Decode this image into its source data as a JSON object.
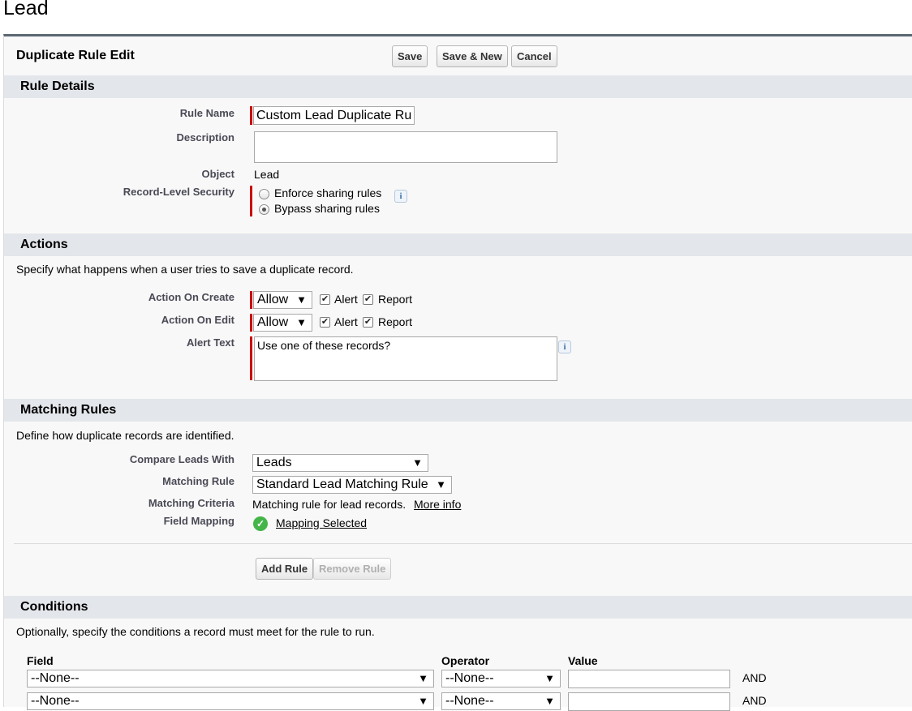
{
  "page_title": "Lead",
  "header": {
    "title": "Duplicate Rule Edit",
    "save_label": "Save",
    "save_new_label": "Save & New",
    "cancel_label": "Cancel"
  },
  "rule_details": {
    "heading": "Rule Details",
    "rule_name_label": "Rule Name",
    "rule_name_value": "Custom Lead Duplicate Rul",
    "description_label": "Description",
    "description_value": "",
    "object_label": "Object",
    "object_value": "Lead",
    "security_label": "Record-Level Security",
    "security_options": [
      "Enforce sharing rules",
      "Bypass sharing rules"
    ],
    "security_selected": "Bypass sharing rules",
    "info_glyph": "i"
  },
  "actions": {
    "heading": "Actions",
    "description": "Specify what happens when a user tries to save a duplicate record.",
    "on_create_label": "Action On Create",
    "on_create_value": "Allow",
    "on_edit_label": "Action On Edit",
    "on_edit_value": "Allow",
    "alert_label": "Alert",
    "report_label": "Report",
    "on_create_alert_checked": true,
    "on_create_report_checked": true,
    "on_edit_alert_checked": true,
    "on_edit_report_checked": true,
    "alert_text_label": "Alert Text",
    "alert_text_value": "Use one of these records?"
  },
  "matching_rules": {
    "heading": "Matching Rules",
    "description": "Define how duplicate records are identified.",
    "compare_label": "Compare Leads With",
    "compare_value": "Leads",
    "matching_rule_label": "Matching Rule",
    "matching_rule_value": "Standard Lead Matching Rule",
    "criteria_label": "Matching Criteria",
    "criteria_value": "Matching rule for lead records.",
    "more_info_label": "More info",
    "field_mapping_label": "Field Mapping",
    "field_mapping_value": "Mapping Selected",
    "add_rule_label": "Add Rule",
    "remove_rule_label": "Remove Rule"
  },
  "conditions": {
    "heading": "Conditions",
    "description": "Optionally, specify the conditions a record must meet for the rule to run.",
    "columns": [
      "Field",
      "Operator",
      "Value"
    ],
    "rows": [
      {
        "field": "--None--",
        "operator": "--None--",
        "value": "",
        "conjunction": "AND"
      },
      {
        "field": "--None--",
        "operator": "--None--",
        "value": "",
        "conjunction": "AND"
      }
    ]
  },
  "icons": {
    "dropdown_arrow": "▼",
    "check_mark": "✔",
    "ok_mark": "✓"
  },
  "colors": {
    "required_bar": "#cc0000",
    "section_header_bg": "#e3e6ea",
    "panel_top_border": "#5b6873",
    "ok_icon": "#44b549"
  }
}
